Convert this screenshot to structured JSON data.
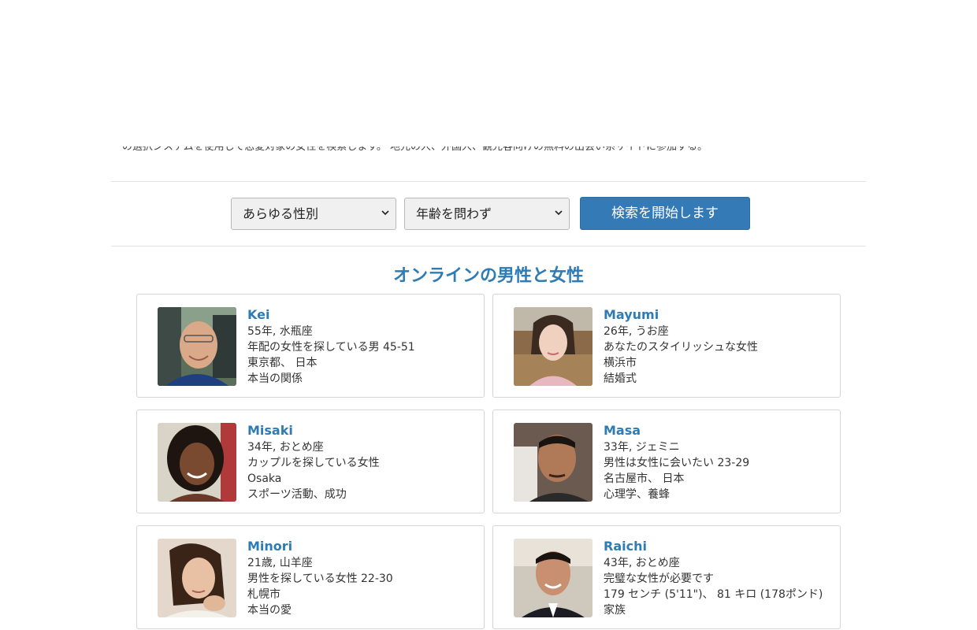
{
  "intro": {
    "text": "の選択システムを使用して恋愛対象の女性を検索します。 地元の人、外国人、観光客向けの無料の出会い系サイトに参加する。"
  },
  "filters": {
    "gender_select": "あらゆる性別",
    "age_select": "年齢を問わず",
    "search_button": "検索を開始します"
  },
  "section": {
    "title": "オンラインの男性と女性"
  },
  "profiles": [
    {
      "name": "Kei",
      "age_sign": "55年, 水瓶座",
      "seeking": "年配の女性を探している男 45-51",
      "location": "東京都、 日本",
      "interest": "本当の関係"
    },
    {
      "name": "Mayumi",
      "age_sign": "26年, うお座",
      "seeking": "あなたのスタイリッシュな女性",
      "location": "横浜市",
      "interest": "結婚式"
    },
    {
      "name": "Misaki",
      "age_sign": "34年, おとめ座",
      "seeking": "カップルを探している女性",
      "location": "Osaka",
      "interest": "スポーツ活動、成功"
    },
    {
      "name": "Masa",
      "age_sign": "33年, ジェミニ",
      "seeking": "男性は女性に会いたい 23-29",
      "location": "名古屋市、 日本",
      "interest": "心理学、養蜂"
    },
    {
      "name": "Minori",
      "age_sign": "21歳, 山羊座",
      "seeking": "男性を探している女性 22-30",
      "location": "札幌市",
      "interest": "本当の愛"
    },
    {
      "name": "Raichi",
      "age_sign": "43年, おとめ座",
      "seeking": "完璧な女性が必要です",
      "location": "179 センチ (5'11\")、 81 キロ (178ポンド)",
      "interest": "家族"
    }
  ],
  "colors": {
    "accent": "#337ab7",
    "name": "#2f7bb3",
    "border": "#d6d6d6"
  }
}
